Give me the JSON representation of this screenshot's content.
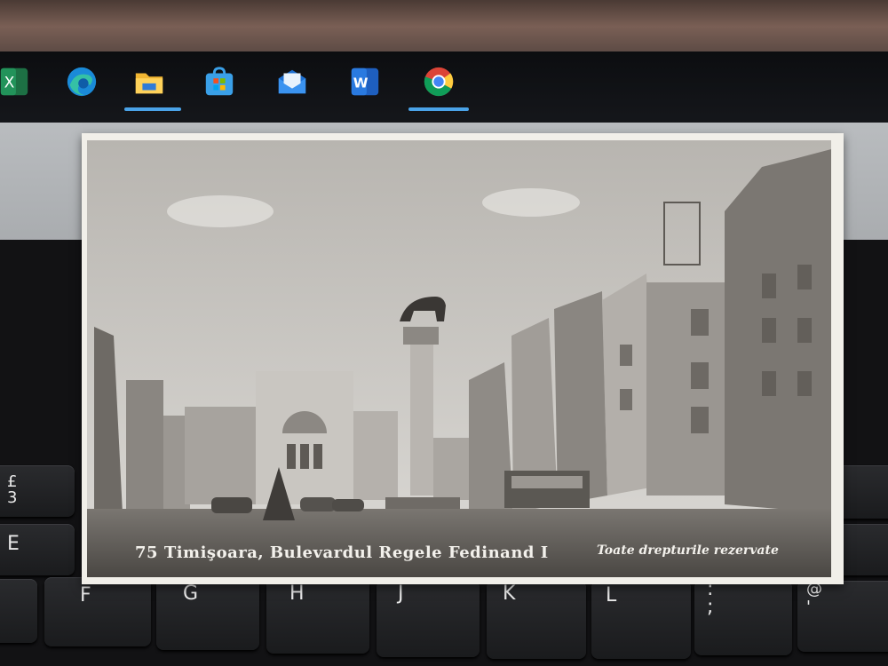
{
  "taskbar": {
    "apps": [
      {
        "name": "excel-icon",
        "label": "X"
      },
      {
        "name": "edge-icon",
        "label": ""
      },
      {
        "name": "file-explorer-icon",
        "label": ""
      },
      {
        "name": "microsoft-store-icon",
        "label": ""
      },
      {
        "name": "mail-icon",
        "label": ""
      },
      {
        "name": "word-icon",
        "label": "W"
      },
      {
        "name": "chrome-icon",
        "label": ""
      }
    ]
  },
  "postcard": {
    "caption": "75 Timişoara, Bulevardul Regele Fedinand I",
    "rights": "Toate drepturile rezervate"
  },
  "keyboard": {
    "keys": [
      {
        "label": "£\n3"
      },
      {
        "label": "E"
      },
      {
        "label": "F"
      },
      {
        "label": "G"
      },
      {
        "label": "H"
      },
      {
        "label": "J"
      },
      {
        "label": "K"
      },
      {
        "label": "L"
      },
      {
        "label": ":\n;"
      },
      {
        "label": "@\n'"
      }
    ]
  },
  "colors": {
    "taskbar_bg": "#0c0d10",
    "indicator": "#4aa3e8",
    "photo_sepia": "#d7d5d0"
  }
}
